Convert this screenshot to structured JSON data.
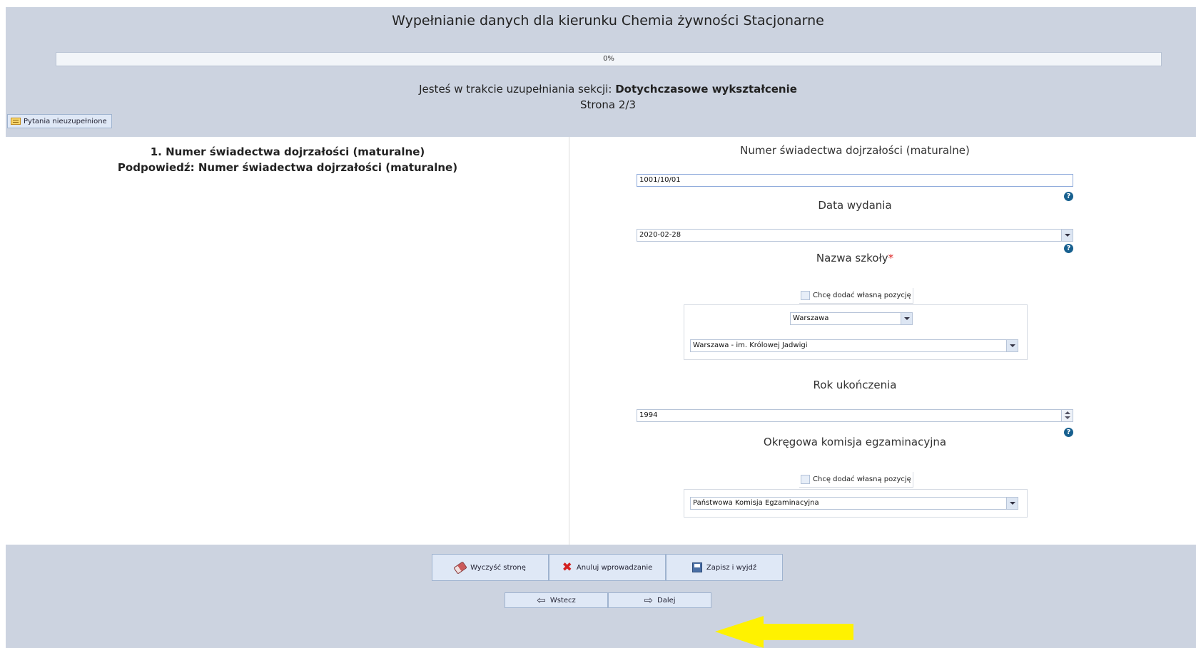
{
  "header": {
    "title": "Wypełnianie danych dla kierunku Chemia żywności Stacjonarne",
    "progress_label": "0%",
    "progress_value": 0,
    "section_prefix": "Jesteś w trakcie uzupełniania sekcji:",
    "section_name": "Dotychczasowe wykształcenie",
    "page_label": "Strona 2/3",
    "unfilled_button": "Pytania nieuzupełnione"
  },
  "question": {
    "title": "1. Numer świadectwa dojrzałości (maturalne)",
    "hint": "Podpowiedź: Numer świadectwa dojrzałości (maturalne)"
  },
  "form": {
    "certificate_label": "Numer świadectwa dojrzałości (maturalne)",
    "certificate_value": "1001/10/01",
    "issue_date_label": "Data wydania",
    "issue_date_value": "2020-02-28",
    "school_label": "Nazwa szkoły",
    "school_required": "*",
    "school_custom_checkbox": "Chcę dodać własną pozycję",
    "city_value": "Warszawa",
    "school_value": "Warszawa - im. Królowej Jadwigi",
    "graduation_year_label": "Rok ukończenia",
    "graduation_year_value": "1994",
    "exam_board_label": "Okręgowa komisja egzaminacyjna",
    "exam_board_custom_checkbox": "Chcę dodać własną pozycję",
    "exam_board_value": "Państwowa Komisja Egzaminacyjna"
  },
  "footer": {
    "clear_button": "Wyczyść stronę",
    "cancel_button": "Anuluj wprowadzanie",
    "save_exit_button": "Zapisz i wyjdź",
    "back_button": "Wstecz",
    "next_button": "Dalej"
  },
  "colors": {
    "header_bg": "#ccd3e0",
    "button_bg": "#dfe8f6",
    "highlight_arrow": "#fff200"
  }
}
